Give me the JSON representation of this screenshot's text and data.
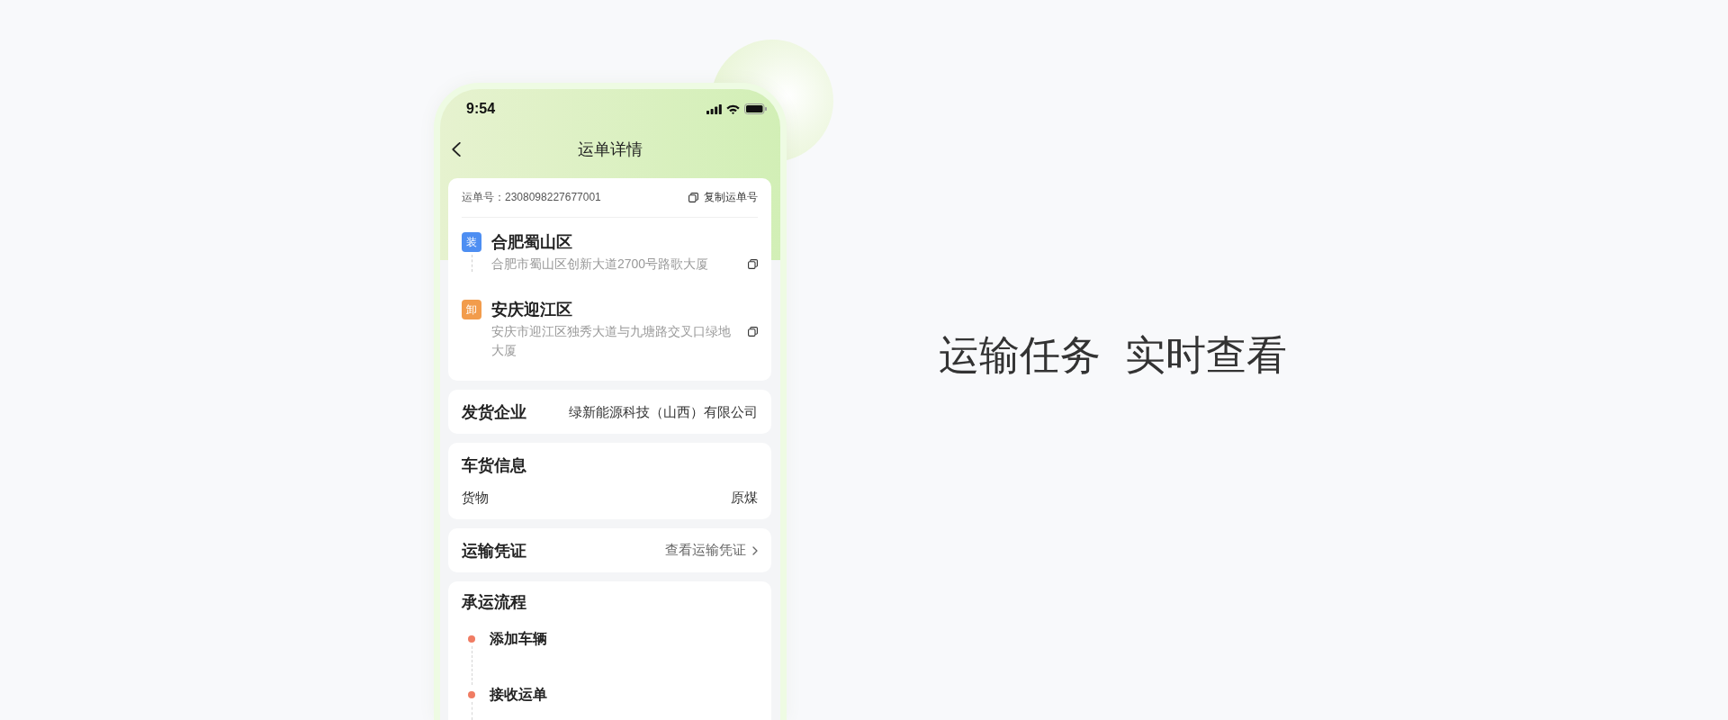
{
  "phone": {
    "status_bar": {
      "time": "9:54"
    },
    "nav": {
      "title": "运单详情"
    },
    "waybill": {
      "number": "运单号：2308098227677001",
      "copy_label": "复制运单号"
    },
    "stops": [
      {
        "tag": "装",
        "color": "#4d8ef2",
        "place": "合肥蜀山区",
        "address": "合肥市蜀山区创新大道2700号路歌大厦"
      },
      {
        "tag": "卸",
        "color": "#f29c4c",
        "place": "安庆迎江区",
        "address": "安庆市迎江区独秀大道与九塘路交叉口绿地大厦"
      }
    ],
    "shipper": {
      "label": "发货企业",
      "value": "绿新能源科技（山西）有限公司"
    },
    "cargo": {
      "title": "车货信息",
      "rows": [
        {
          "label": "货物",
          "value": "原煤"
        }
      ]
    },
    "voucher": {
      "label": "运输凭证",
      "link": "查看运输凭证"
    },
    "process": {
      "title": "承运流程",
      "steps": [
        {
          "label": "添加车辆"
        },
        {
          "label": "接收运单"
        }
      ]
    }
  },
  "headline": "运输任务 实时查看"
}
